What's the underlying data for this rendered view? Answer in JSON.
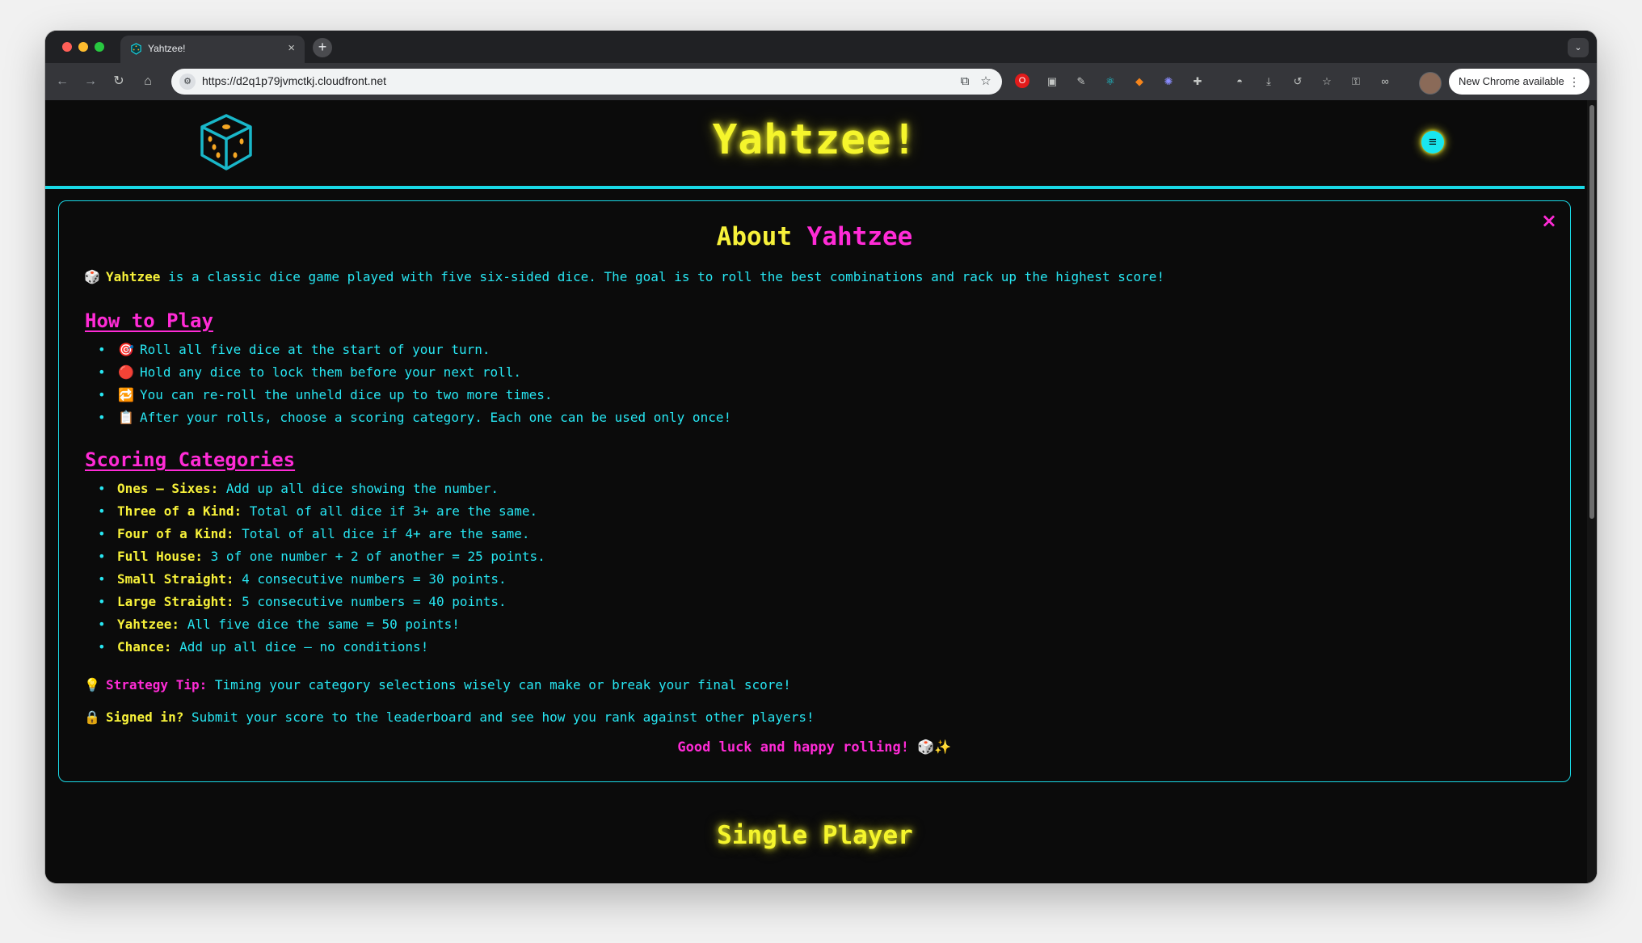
{
  "browser": {
    "tab_title": "Yahtzee!",
    "tab_close": "×",
    "new_tab": "+",
    "tab_search": "⌄",
    "url": "https://d2q1p79jvmctkj.cloudfront.net",
    "update_label": "New Chrome available",
    "update_menu": "⋮",
    "nav": {
      "back": "←",
      "forward": "→",
      "reload": "↻",
      "home": "⌂"
    }
  },
  "header": {
    "title": "Yahtzee!",
    "menu_icon": "≡"
  },
  "about": {
    "close": "×",
    "title_part1": "About",
    "title_part2": "Yahtzee",
    "intro_emoji": "🎲",
    "intro_bold": "Yahtzee",
    "intro_text": " is a classic dice game played with five six-sided dice. The goal is to roll the best combinations and rack up the highest score!",
    "how_to_play": {
      "heading": "How to Play",
      "items": [
        {
          "emoji": "🎯",
          "text": "Roll all five dice at the start of your turn."
        },
        {
          "emoji": "🔴",
          "text": "Hold any dice to lock them before your next roll."
        },
        {
          "emoji": "🔁",
          "text": "You can re-roll the unheld dice up to two more times."
        },
        {
          "emoji": "📋",
          "text": "After your rolls, choose a scoring category. Each one can be used only once!"
        }
      ]
    },
    "scoring": {
      "heading": "Scoring Categories",
      "items": [
        {
          "label": "Ones – Sixes:",
          "text": " Add up all dice showing the number."
        },
        {
          "label": "Three of a Kind:",
          "text": " Total of all dice if 3+ are the same."
        },
        {
          "label": "Four of a Kind:",
          "text": " Total of all dice if 4+ are the same."
        },
        {
          "label": "Full House:",
          "text": " 3 of one number + 2 of another = 25 points."
        },
        {
          "label": "Small Straight:",
          "text": " 4 consecutive numbers = 30 points."
        },
        {
          "label": "Large Straight:",
          "text": " 5 consecutive numbers = 40 points."
        },
        {
          "label": "Yahtzee:",
          "text": " All five dice the same = 50 points!"
        },
        {
          "label": "Chance:",
          "text": " Add up all dice – no conditions!"
        }
      ]
    },
    "strategy": {
      "emoji": "💡",
      "label": "Strategy Tip:",
      "text": " Timing your category selections wisely can make or break your final score!"
    },
    "signed_in": {
      "emoji": "🔒",
      "label": "Signed in?",
      "text": " Submit your score to the leaderboard and see how you rank against other players!"
    },
    "good_luck": "Good luck and happy rolling! 🎲✨"
  },
  "single_player": {
    "heading": "Single Player"
  },
  "colors": {
    "neon_yellow": "#f5f52c",
    "neon_pink": "#ff2bd6",
    "neon_cyan": "#19d9e6",
    "background": "#0b0b0b"
  }
}
